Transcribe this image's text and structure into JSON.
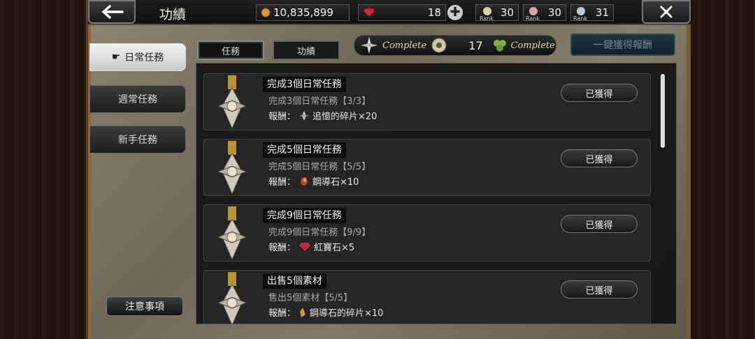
{
  "header": {
    "title": "功績",
    "currency": {
      "coins": "10,835,899",
      "gems": "18"
    },
    "ranks": [
      {
        "value": "30",
        "label": "Rank"
      },
      {
        "value": "30",
        "label": "Rank"
      },
      {
        "value": "31",
        "label": "Rank"
      }
    ]
  },
  "sidebar": {
    "items": [
      {
        "label": "日常任務",
        "active": true
      },
      {
        "label": "週常任務",
        "active": false
      },
      {
        "label": "新手任務",
        "active": false
      }
    ],
    "notes_label": "注意事項"
  },
  "tabs": [
    {
      "label": "任務",
      "active": true
    },
    {
      "label": "功績",
      "active": false
    }
  ],
  "completion": {
    "left_label": "Complete",
    "count": "17",
    "right_label": "Complete"
  },
  "claim_all_label": "一鍵獲得報酬",
  "missions": [
    {
      "title": "完成3個日常任務",
      "progress": "完成3個日常任務【3/3】",
      "reward_label": "報酬：",
      "reward": "追憶的碎片×20",
      "reward_icon": "shard-icon",
      "button": "已獲得"
    },
    {
      "title": "完成5個日常任務",
      "progress": "完成5個日常任務【5/5】",
      "reward_label": "報酬：",
      "reward": "鋼導石×10",
      "reward_icon": "ore-icon",
      "button": "已獲得"
    },
    {
      "title": "完成9個日常任務",
      "progress": "完成9個日常任務【9/9】",
      "reward_label": "報酬：",
      "reward": "紅寶石×5",
      "reward_icon": "ruby-icon",
      "button": "已獲得"
    },
    {
      "title": "出售5個素材",
      "progress": "售出5個素材【5/5】",
      "reward_label": "報酬：",
      "reward": "鋼導石的碎片×10",
      "reward_icon": "ore-shard-icon",
      "button": "已獲得"
    }
  ]
}
